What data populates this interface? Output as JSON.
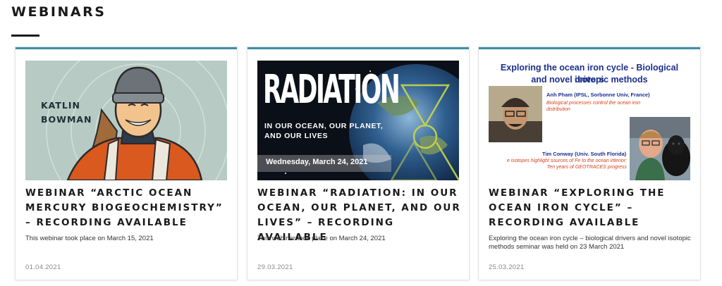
{
  "section": {
    "title": "WEBINARS"
  },
  "cards": [
    {
      "title": "WEBINAR “ARCTIC OCEAN MERCURY BIOGEOCHEMISTRY” – RECORDING AVAILABLE",
      "description": "This webinar took place on March 15, 2021",
      "date": "01.04.2021",
      "thumb": {
        "name_line1": "KATLIN",
        "name_line2": "BOWMAN"
      }
    },
    {
      "title": "WEBINAR “RADIATION: IN OUR OCEAN, OUR PLANET, AND OUR LIVES” – RECORDING AVAILABLE",
      "description": "This webinar took place on March 24, 2021",
      "date": "29.03.2021",
      "thumb": {
        "headline": "RADIATION",
        "sub_line1": "IN OUR OCEAN, OUR PLANET,",
        "sub_line2": "AND OUR LIVES",
        "date_text": "Wednesday, March 24, 2021"
      }
    },
    {
      "title": "WEBINAR “EXPLORING THE OCEAN IRON CYCLE” – RECORDING AVAILABLE",
      "description": "Exploring the ocean iron cycle – biological drivers and novel isotopic methods seminar was held on 23 March 2021",
      "date": "25.03.2021",
      "thumb": {
        "headline_line1": "Exploring the ocean iron cycle -  Biological drivers",
        "headline_line2": "and novel isotopic methods",
        "speaker1": "Anh Pham (IPSL, Sorbonne Univ, France)",
        "speaker1_topic": "Biological processes control the ocean iron distribution",
        "speaker2": "Tim Conway (Univ. South Florida)",
        "speaker2_topic_line1": "e isotopes highlight sources of Fe to the ocean interior:",
        "speaker2_topic_line2": "Ten years of GEOTRACES progress"
      }
    }
  ],
  "colors": {
    "card_accent": "#3f8fa8",
    "thumb3_blue": "#1b2f8e",
    "thumb3_orange": "#d8401a"
  }
}
